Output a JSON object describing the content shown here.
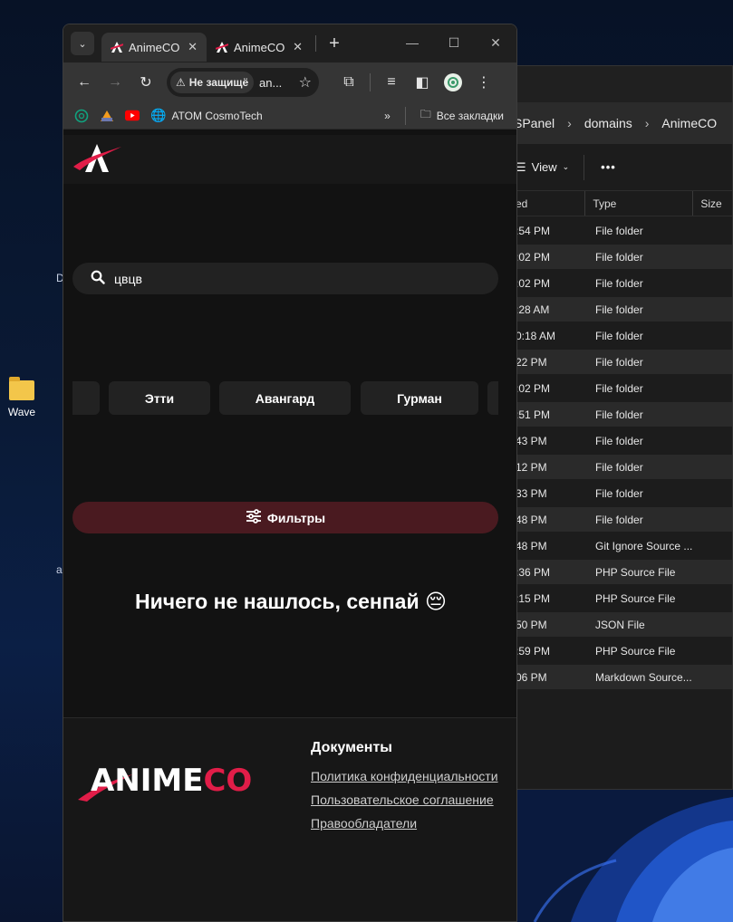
{
  "desktop": {
    "icon_label": "Wave",
    "frag_d": "D",
    "frag_a": "a"
  },
  "explorer": {
    "breadcrumb": [
      "SPanel",
      "domains",
      "AnimeCO"
    ],
    "view_label": "View",
    "more_label": "•••",
    "columns": {
      "modified": "ed",
      "type": "Type",
      "size": "Size"
    },
    "rows": [
      {
        "modified": ":54 PM",
        "type": "File folder"
      },
      {
        "modified": ":02 PM",
        "type": "File folder"
      },
      {
        "modified": ":02 PM",
        "type": "File folder"
      },
      {
        "modified": ":28 AM",
        "type": "File folder"
      },
      {
        "modified": "0:18 AM",
        "type": "File folder"
      },
      {
        "modified": "22 PM",
        "type": "File folder"
      },
      {
        "modified": ":02 PM",
        "type": "File folder"
      },
      {
        "modified": ":51 PM",
        "type": "File folder"
      },
      {
        "modified": "43 PM",
        "type": "File folder"
      },
      {
        "modified": "12 PM",
        "type": "File folder"
      },
      {
        "modified": "33 PM",
        "type": "File folder"
      },
      {
        "modified": "48 PM",
        "type": "File folder"
      },
      {
        "modified": "48 PM",
        "type": "Git Ignore Source ..."
      },
      {
        "modified": ":36 PM",
        "type": "PHP Source File"
      },
      {
        "modified": ":15 PM",
        "type": "PHP Source File"
      },
      {
        "modified": "50 PM",
        "type": "JSON File"
      },
      {
        "modified": ":59 PM",
        "type": "PHP Source File"
      },
      {
        "modified": "06 PM",
        "type": "Markdown Source..."
      }
    ]
  },
  "browser": {
    "tabs": [
      {
        "title": "AnimeCO"
      },
      {
        "title": "AnimeCO"
      }
    ],
    "omnibox": {
      "security_label": "Не защищё",
      "url": "an..."
    },
    "bookmarks": {
      "item_label": "ATOM CosmoTech",
      "all_bookmarks": "Все закладки"
    }
  },
  "site": {
    "search_value": "цвцв",
    "genres": [
      "Этти",
      "Авангард",
      "Гурман"
    ],
    "filters_label": "Фильтры",
    "empty_message": "Ничего не нашлось, сенпай 😔",
    "footer": {
      "logo_main": "ANIME",
      "logo_accent": "CO",
      "docs_title": "Документы",
      "links": [
        "Политика конфиденциальности",
        "Пользовательское соглашение",
        "Правообладатели"
      ]
    }
  },
  "colors": {
    "accent": "#e11d48",
    "filters_bg": "#4a1a20"
  }
}
